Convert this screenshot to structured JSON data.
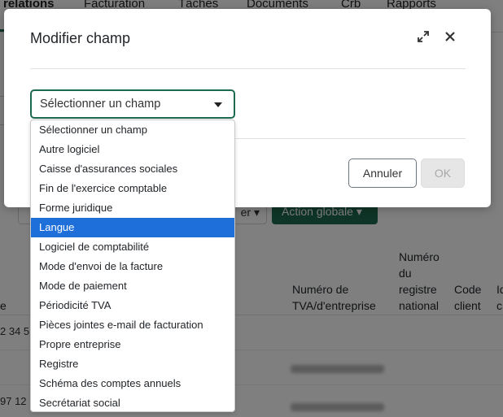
{
  "background": {
    "nav": [
      "relations",
      "Facturation",
      "Tâches",
      "Documents",
      "Crb",
      "Rapports"
    ],
    "filter_button": "er",
    "action_button": "Action globale",
    "table_headers": {
      "col_e": "e",
      "tva": "Numéro de TVA/d'entreprise",
      "registre": "Numéro du registre national",
      "code_client": "Code client",
      "cut": "Id c"
    },
    "rows": [
      "2 34 5",
      "",
      "97 12"
    ]
  },
  "modal": {
    "title": "Modifier champ",
    "select_value": "Sélectionner un champ",
    "cancel_label": "Annuler",
    "ok_label": "OK"
  },
  "dropdown": {
    "options": [
      "Sélectionner un champ",
      "Autre logiciel",
      "Caisse d'assurances sociales",
      "Fin de l'exercice comptable",
      "Forme juridique",
      "Langue",
      "Logiciel de comptabilité",
      "Mode d'envoi de la facture",
      "Mode de paiement",
      "Périodicité TVA",
      "Pièces jointes e-mail de facturation",
      "Propre entreprise",
      "Registre",
      "Schéma des comptes annuels",
      "Secrétariat social"
    ],
    "highlighted": "Langue"
  },
  "colors": {
    "accent": "#1d6b4f",
    "highlight": "#1e6fd9"
  }
}
